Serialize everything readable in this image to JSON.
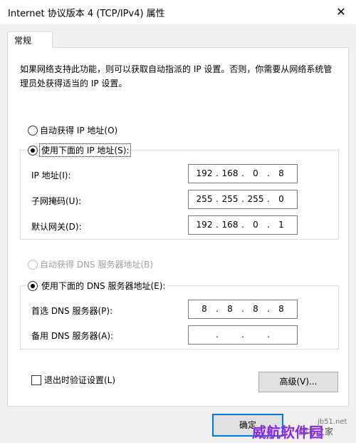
{
  "window": {
    "title": "Internet 协议版本 4 (TCP/IPv4) 属性",
    "close_glyph": "✕"
  },
  "tabs": [
    {
      "label": "常规"
    }
  ],
  "description": "如果网络支持此功能，则可以获取自动指派的 IP 设置。否则，你需要从网络系统管理员处获得适当的 IP 设置。",
  "ip": {
    "auto_label": "自动获得 IP 地址(O)",
    "manual_label": "使用下面的 IP 地址(S):",
    "address_label": "IP 地址(I):",
    "address": [
      "192",
      "168",
      "0",
      "8"
    ],
    "mask_label": "子网掩码(U):",
    "mask": [
      "255",
      "255",
      "255",
      "0"
    ],
    "gateway_label": "默认网关(D):",
    "gateway": [
      "192",
      "168",
      "0",
      "1"
    ]
  },
  "dns": {
    "auto_label": "自动获得 DNS 服务器地址(B)",
    "manual_label": "使用下面的 DNS 服务器地址(E):",
    "preferred_label": "首选 DNS 服务器(P):",
    "preferred": [
      "8",
      "8",
      "8",
      "8"
    ],
    "alternate_label": "备用 DNS 服务器(A):",
    "alternate": [
      "",
      "",
      "",
      ""
    ]
  },
  "validate_label": "退出时验证设置(L)",
  "advanced_label": "高级(V)...",
  "ok_label": "确定",
  "dot": ".",
  "watermark": {
    "line1": "jb51.net",
    "line2": "脚本之家",
    "line3": "威航软件园"
  }
}
